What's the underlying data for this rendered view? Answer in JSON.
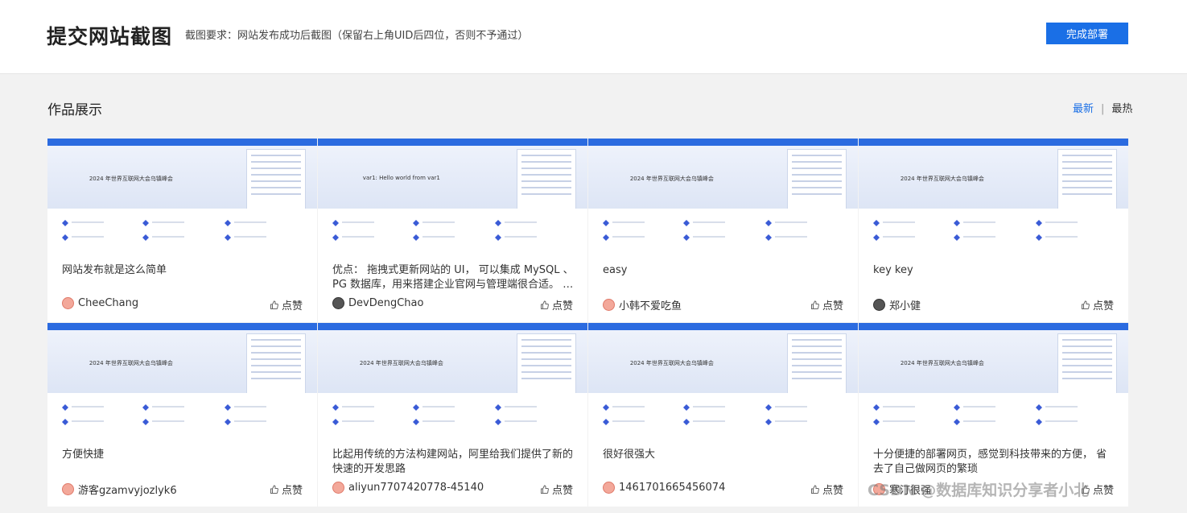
{
  "header": {
    "title": "提交网站截图",
    "requirement": "截图要求：网站发布成功后截图（保留右上角UID后四位，否则不予通过）",
    "complete_button": "完成部署"
  },
  "showcase": {
    "title": "作品展示",
    "sort_latest": "最新",
    "sort_separator": "|",
    "sort_hottest": "最热"
  },
  "cards": [
    {
      "desc": "网站发布就是这么简单",
      "author": "CheeChang",
      "like": "点赞",
      "thumb_title": "2024 年世界互联网大会乌镇峰会"
    },
    {
      "desc": "优点： 拖拽式更新网站的 UI， 可以集成 MySQL 、PG 数据库，用来搭建企业官网与管理端很合适。 自带版本管理，方便回滚。",
      "author": "DevDengChao",
      "like": "点赞",
      "thumb_title": "var1: Hello world from var1"
    },
    {
      "desc": "easy",
      "author": "小韩不爱吃鱼",
      "like": "点赞",
      "thumb_title": "2024 年世界互联网大会乌镇峰会"
    },
    {
      "desc": "key key",
      "author": "郑小健",
      "like": "点赞",
      "thumb_title": "2024 年世界互联网大会乌镇峰会"
    },
    {
      "desc": "方便快捷",
      "author": "游客gzamvyjozlyk6",
      "like": "点赞",
      "thumb_title": "2024 年世界互联网大会乌镇峰会"
    },
    {
      "desc": "比起用传统的方法构建网站，阿里给我们提供了新的快速的开发思路",
      "author": "aliyun7707420778-45140",
      "like": "点赞",
      "thumb_title": "2024 年世界互联网大会乌镇峰会"
    },
    {
      "desc": "很好很强大",
      "author": "1461701665456074",
      "like": "点赞",
      "thumb_title": "2024 年世界互联网大会乌镇峰会"
    },
    {
      "desc": "十分便捷的部署网页，感觉到科技带来的方便， 省去了自己做网页的繁琐",
      "author": "寒汀很强",
      "like": "点赞",
      "thumb_title": "2024 年世界互联网大会乌镇峰会"
    }
  ],
  "watermark": "CSDN @数据库知识分享者小北",
  "colors": {
    "accent": "#1a6fe6",
    "background": "#f2f2f2"
  }
}
